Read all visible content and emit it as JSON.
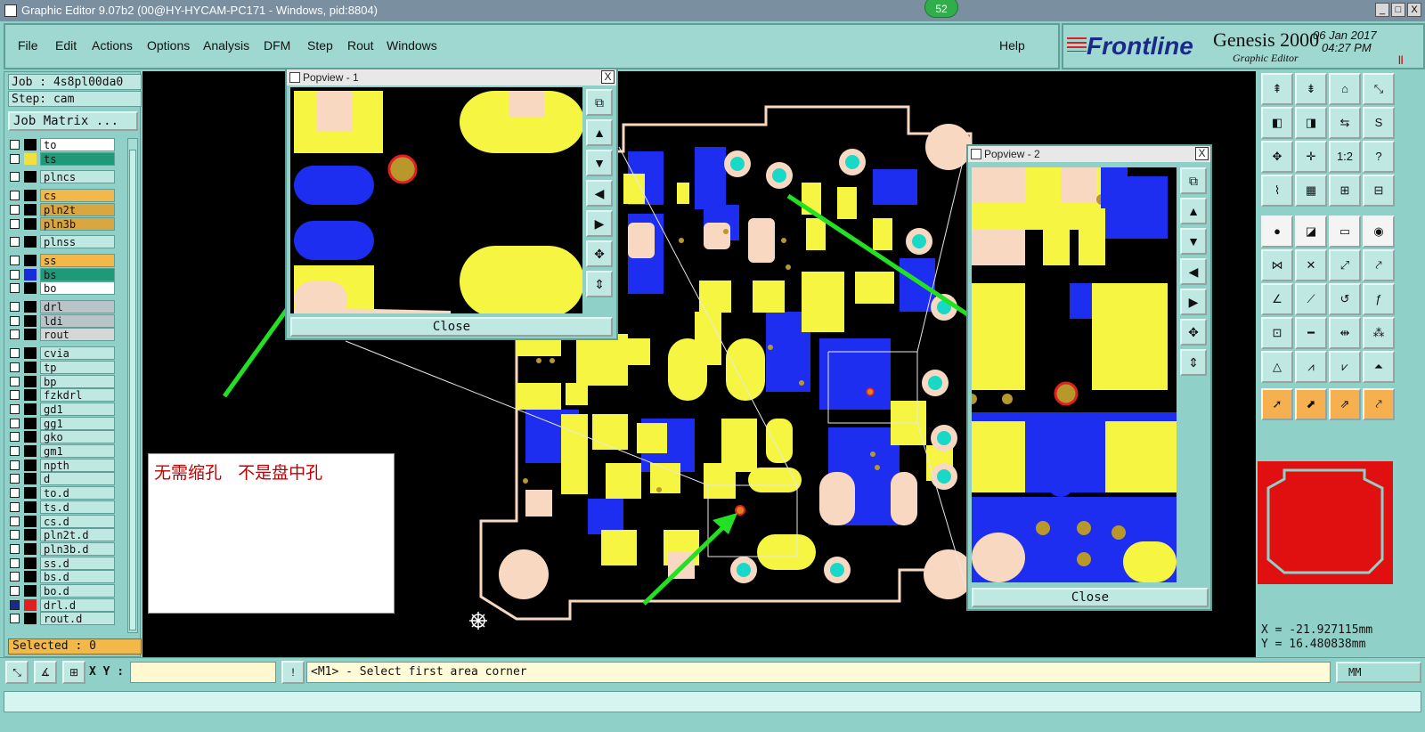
{
  "window": {
    "title": "Graphic Editor 9.07b2 (00@HY-HYCAM-PC171 - Windows, pid:8804)",
    "badge_count": "52",
    "min_label": "_",
    "max_label": "□",
    "close_label": "X"
  },
  "menu": {
    "items": [
      "File",
      "Edit",
      "Actions",
      "Options",
      "Analysis",
      "DFM",
      "Step",
      "Rout",
      "Windows"
    ],
    "help": "Help"
  },
  "brand": {
    "logo": "Frontline",
    "product": "Genesis 2000",
    "subtitle": "Graphic Editor",
    "date": "06 Jan 2017",
    "time": "04:27 PM",
    "pause_glyph": "||"
  },
  "left_panel": {
    "job": "Job : 4s8pl00da0",
    "step": "Step: cam",
    "job_matrix_button": "Job Matrix ...",
    "selected": "Selected : 0",
    "layers": [
      {
        "name": "to",
        "color": "#ffffff",
        "swatch": "#000000"
      },
      {
        "name": "ts",
        "color": "#1e9a78",
        "swatch": "#f0e040"
      },
      {
        "name": "plncs",
        "color": "#bfe8e2",
        "swatch": "#000000"
      },
      {
        "name": "cs",
        "color": "#f2b84a",
        "swatch": "#000000"
      },
      {
        "name": "pln2t",
        "color": "#d9a640",
        "swatch": "#000000"
      },
      {
        "name": "pln3b",
        "color": "#d9a640",
        "swatch": "#000000"
      },
      {
        "name": "plnss",
        "color": "#bfe8e2",
        "swatch": "#000000"
      },
      {
        "name": "ss",
        "color": "#f2b84a",
        "swatch": "#000000"
      },
      {
        "name": "bs",
        "color": "#1e9a78",
        "swatch": "#1a2bd8"
      },
      {
        "name": "bo",
        "color": "#ffffff",
        "swatch": "#000000"
      },
      {
        "name": "drl",
        "color": "#b8c4c8",
        "swatch": "#000000"
      },
      {
        "name": "ldi",
        "color": "#b8c4c8",
        "swatch": "#000000"
      },
      {
        "name": "rout",
        "color": "#d6d6d6",
        "swatch": "#000000"
      },
      {
        "name": "cvia",
        "color": "#bfe8e2",
        "swatch": "#000000"
      },
      {
        "name": "tp",
        "color": "#bfe8e2",
        "swatch": "#000000"
      },
      {
        "name": "bp",
        "color": "#bfe8e2",
        "swatch": "#000000"
      },
      {
        "name": "fzkdrl",
        "color": "#bfe8e2",
        "swatch": "#000000"
      },
      {
        "name": "gd1",
        "color": "#bfe8e2",
        "swatch": "#000000"
      },
      {
        "name": "gg1",
        "color": "#bfe8e2",
        "swatch": "#000000"
      },
      {
        "name": "gko",
        "color": "#bfe8e2",
        "swatch": "#000000"
      },
      {
        "name": "gm1",
        "color": "#bfe8e2",
        "swatch": "#000000"
      },
      {
        "name": "npth",
        "color": "#bfe8e2",
        "swatch": "#000000"
      },
      {
        "name": "d",
        "color": "#bfe8e2",
        "swatch": "#000000"
      },
      {
        "name": "to.d",
        "color": "#bfe8e2",
        "swatch": "#000000"
      },
      {
        "name": "ts.d",
        "color": "#bfe8e2",
        "swatch": "#000000"
      },
      {
        "name": "cs.d",
        "color": "#bfe8e2",
        "swatch": "#000000"
      },
      {
        "name": "pln2t.d",
        "color": "#bfe8e2",
        "swatch": "#000000"
      },
      {
        "name": "pln3b.d",
        "color": "#bfe8e2",
        "swatch": "#000000"
      },
      {
        "name": "ss.d",
        "color": "#bfe8e2",
        "swatch": "#000000"
      },
      {
        "name": "bs.d",
        "color": "#bfe8e2",
        "swatch": "#000000"
      },
      {
        "name": "bo.d",
        "color": "#bfe8e2",
        "swatch": "#000000"
      },
      {
        "name": "drl.d",
        "color": "#bfe8e2",
        "swatch": "#e02020",
        "checked": true
      },
      {
        "name": "rout.d",
        "color": "#bfe8e2",
        "swatch": "#000000"
      }
    ]
  },
  "popview1": {
    "title": "Popview - 1",
    "close": "Close",
    "x_label": "X"
  },
  "popview2": {
    "title": "Popview - 2",
    "close": "Close",
    "x_label": "X"
  },
  "note": {
    "text": "无需缩孔   不是盘中孔"
  },
  "coords": {
    "x": "X = -21.927115mm",
    "y": "Y = 16.480838mm"
  },
  "bottom": {
    "xy_label": "X Y :",
    "xy_value": "",
    "prompt": "<M1> - Select first area corner",
    "unit": "MM",
    "info_glyph": "!"
  },
  "colors": {
    "pad_yellow": "#f5f542",
    "pad_blue": "#1e2ef0",
    "pad_peach": "#f8d8c0",
    "pad_cyan": "#18d8c8",
    "arrow_green": "#22e022",
    "drill_red": "#e02020",
    "drill_gold": "#b8982a"
  }
}
